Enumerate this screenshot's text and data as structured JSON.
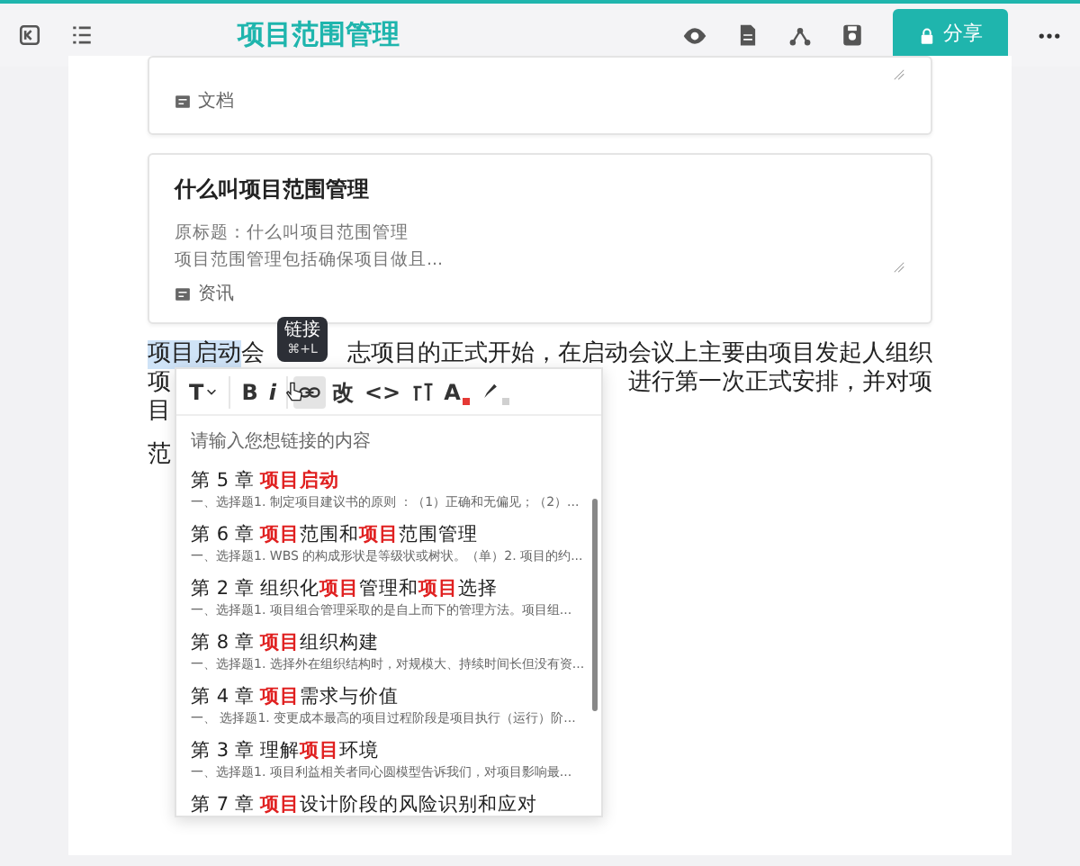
{
  "header": {
    "title": "项目范围管理",
    "share_button": "分享"
  },
  "cards": [
    {
      "kind": "partial",
      "tag": "文档"
    },
    {
      "kind": "full",
      "title": "什么叫项目范围管理",
      "lines": [
        "原标题：什么叫项目范围管理",
        "项目范围管理包括确保项目做且..."
      ],
      "tag": "资讯"
    }
  ],
  "paragraph_lines": [
    [
      {
        "text": "项目启动",
        "selected": true
      },
      {
        "text": "会",
        "selected": false
      },
      {
        "kind": "covered"
      },
      {
        "text": "志项目的正式开始，在启动会议上主要由项目发起人组织",
        "selected": false
      }
    ],
    [
      {
        "text": "项",
        "selected": false
      },
      {
        "kind": "covered"
      },
      {
        "text": "进行第一次正式安排，并对项",
        "selected": false
      }
    ],
    [
      {
        "text": "目",
        "selected": false
      }
    ],
    [
      {
        "text": "范",
        "selected": false
      }
    ]
  ],
  "tooltip": {
    "label": "链接",
    "shortcut": "⌘+L"
  },
  "toolbar": {
    "groups": [
      [
        {
          "kind": "text",
          "label": "T",
          "caret": true,
          "hovered": false
        }
      ],
      [
        {
          "kind": "text",
          "label": "B",
          "hovered": false
        },
        {
          "kind": "text",
          "label": "i",
          "hovered": false
        }
      ],
      [
        {
          "kind": "link",
          "hovered": true
        },
        {
          "kind": "text",
          "label": "改",
          "hovered": false
        },
        {
          "kind": "text",
          "label": "<>",
          "hovered": false
        },
        {
          "kind": "heading",
          "hovered": false
        },
        {
          "kind": "text",
          "label": "A",
          "color": "#e53935",
          "hovered": false
        },
        {
          "kind": "pen",
          "color": "#d0d0d0",
          "hovered": false
        }
      ]
    ]
  },
  "link_search": {
    "placeholder": "请输入您想链接的内容"
  },
  "results": [
    {
      "title": [
        {
          "text": "第 5 章 ",
          "match": false
        },
        {
          "text": "项目启动",
          "match": true
        }
      ],
      "snippet": "一、选择题1. 制定项目建议书的原则 ：（1）正确和无偏见；（2）..."
    },
    {
      "title": [
        {
          "text": "第 6 章 ",
          "match": false
        },
        {
          "text": "项目",
          "match": true
        },
        {
          "text": "范围和",
          "match": false
        },
        {
          "text": "项目",
          "match": true
        },
        {
          "text": "范围管理",
          "match": false
        }
      ],
      "snippet": "一、选择题1. WBS 的构成形状是等级状或树状。（单）2. 项目的约..."
    },
    {
      "title": [
        {
          "text": "第 2 章 组织化",
          "match": false
        },
        {
          "text": "项目",
          "match": true
        },
        {
          "text": "管理和",
          "match": false
        },
        {
          "text": "项目",
          "match": true
        },
        {
          "text": "选择",
          "match": false
        }
      ],
      "snippet": "一、选择题1. 项目组合管理采取的是自上而下的管理方法。项目组..."
    },
    {
      "title": [
        {
          "text": "第 8 章 ",
          "match": false
        },
        {
          "text": "项目",
          "match": true
        },
        {
          "text": "组织构建",
          "match": false
        }
      ],
      "snippet": "一、选择题1. 选择外在组织结构时，对规模大、持续时间长但没有资..."
    },
    {
      "title": [
        {
          "text": "第 4 章 ",
          "match": false
        },
        {
          "text": "项目",
          "match": true
        },
        {
          "text": "需求与价值",
          "match": false
        }
      ],
      "snippet": "一、 选择题1. 变更成本最高的项目过程阶段是项目执行（运行）阶..."
    },
    {
      "title": [
        {
          "text": "第 3 章 理解",
          "match": false
        },
        {
          "text": "项目",
          "match": true
        },
        {
          "text": "环境",
          "match": false
        }
      ],
      "snippet": "一、选择题1. 项目利益相关者同心圆模型告诉我们，对项目影响最..."
    },
    {
      "title": [
        {
          "text": "第 7 章 ",
          "match": false
        },
        {
          "text": "项目",
          "match": true
        },
        {
          "text": "设计阶段的风险识别和应对",
          "match": false
        }
      ]
    }
  ]
}
